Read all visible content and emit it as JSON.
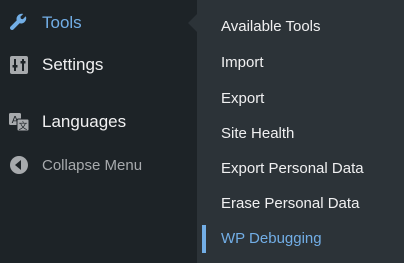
{
  "sidebar": {
    "items": [
      {
        "label": "Tools",
        "icon": "wrench-icon",
        "color": "#72aee6"
      },
      {
        "label": "Settings",
        "icon": "sliders-icon"
      },
      {
        "label": "Languages",
        "icon": "translate-icon"
      },
      {
        "label": "Collapse Menu",
        "icon": "collapse-arrow-icon"
      }
    ]
  },
  "submenu": {
    "items": [
      {
        "label": "Available Tools"
      },
      {
        "label": "Import"
      },
      {
        "label": "Export"
      },
      {
        "label": "Site Health"
      },
      {
        "label": "Export Personal Data"
      },
      {
        "label": "Erase Personal Data"
      },
      {
        "label": "WP Debugging",
        "active": true
      }
    ]
  },
  "colors": {
    "sidebar_bg": "#1d2327",
    "submenu_bg": "#2c3338",
    "accent": "#72aee6"
  }
}
